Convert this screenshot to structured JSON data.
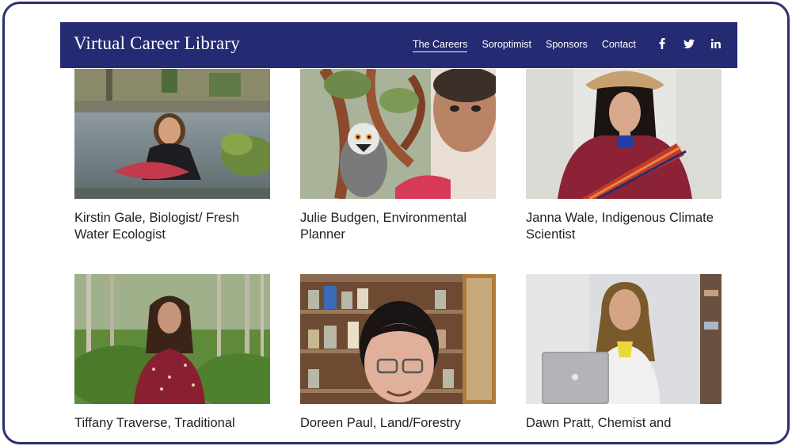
{
  "header": {
    "brand": "Virtual Career Library",
    "nav": [
      {
        "label": "The Careers",
        "active": true
      },
      {
        "label": "Soroptimist",
        "active": false
      },
      {
        "label": "Sponsors",
        "active": false
      },
      {
        "label": "Contact",
        "active": false
      }
    ],
    "social_icons": [
      "facebook-icon",
      "twitter-icon",
      "linkedin-icon"
    ]
  },
  "cards": [
    {
      "caption": "Kirstin Gale, Biologist/ Fresh Water Ecologist"
    },
    {
      "caption": "Julie Budgen, Environmental Planner"
    },
    {
      "caption": "Janna Wale, Indigenous Climate Scientist"
    },
    {
      "caption": "Tiffany Traverse, Traditional"
    },
    {
      "caption": "Doreen Paul, Land/Forestry"
    },
    {
      "caption": "Dawn Pratt, Chemist and"
    }
  ],
  "colors": {
    "navbar": "#242b72",
    "frame": "#2a2f6e",
    "text": "#222222"
  }
}
